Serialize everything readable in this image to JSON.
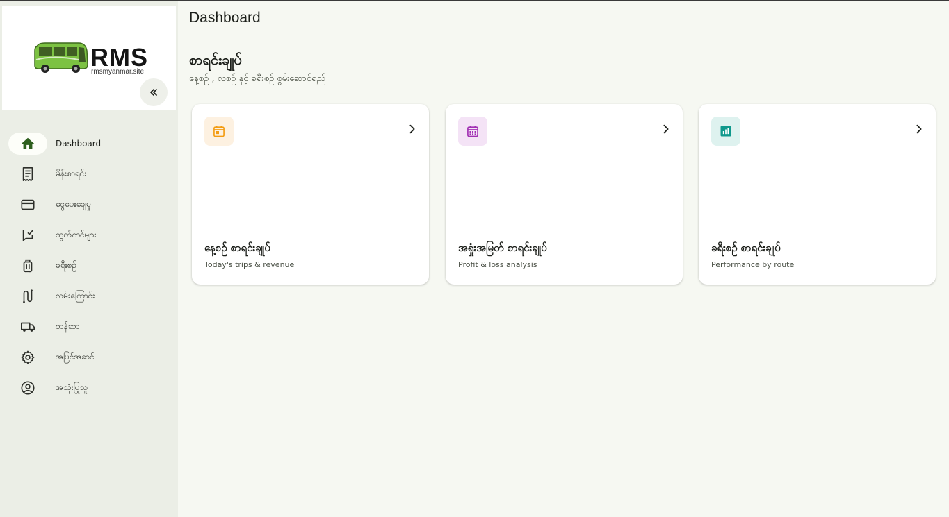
{
  "brand": {
    "name": "RMS",
    "site": "rmsmyanmar.site",
    "bus_color": "#7cc242"
  },
  "sidebar": {
    "collapse_icon": "double-chevron-left-icon",
    "items": [
      {
        "label": "Dashboard",
        "icon": "home-icon",
        "active": true
      },
      {
        "label": "မိန်းစာရင်း",
        "icon": "receipt-icon"
      },
      {
        "label": "ငွေပေးချေမှု",
        "icon": "credit-card-icon"
      },
      {
        "label": "ဘွတ်ကင်များ",
        "icon": "checklist-icon"
      },
      {
        "label": "ခရီးစဉ်",
        "icon": "luggage-icon"
      },
      {
        "label": "လမ်းကြောင်း",
        "icon": "route-icon"
      },
      {
        "label": "တန်ဆာ",
        "icon": "truck-icon"
      },
      {
        "label": "အပြင်အဆင်",
        "icon": "gear-icon"
      },
      {
        "label": "အသုံးပြုသူ",
        "icon": "account-circle-icon"
      }
    ]
  },
  "header": {
    "title": "Dashboard"
  },
  "section": {
    "title": "စာရင်းချုပ်",
    "subtitle": "နေ့စဉ် , လစဉ် နှင့် ခရီးစဉ် စွမ်းဆောင်ရည်"
  },
  "cards": [
    {
      "title": "နေ့စဉ် စာရင်းချုပ်",
      "subtitle": "Today's trips & revenue",
      "icon": "calendar-today-icon",
      "icon_color": "#f39c12",
      "icon_bg": "#fdf1e1"
    },
    {
      "title": "အရှုံးအမြတ် စာရင်းချုပ်",
      "subtitle": "Profit & loss analysis",
      "icon": "calendar-month-icon",
      "icon_color": "#a12fb3",
      "icon_bg": "#f4e3f6"
    },
    {
      "title": "ခရီးစဉ် စာရင်းချုပ်",
      "subtitle": "Performance by route",
      "icon": "analytics-icon",
      "icon_color": "#10998c",
      "icon_bg": "#def2ef"
    }
  ]
}
